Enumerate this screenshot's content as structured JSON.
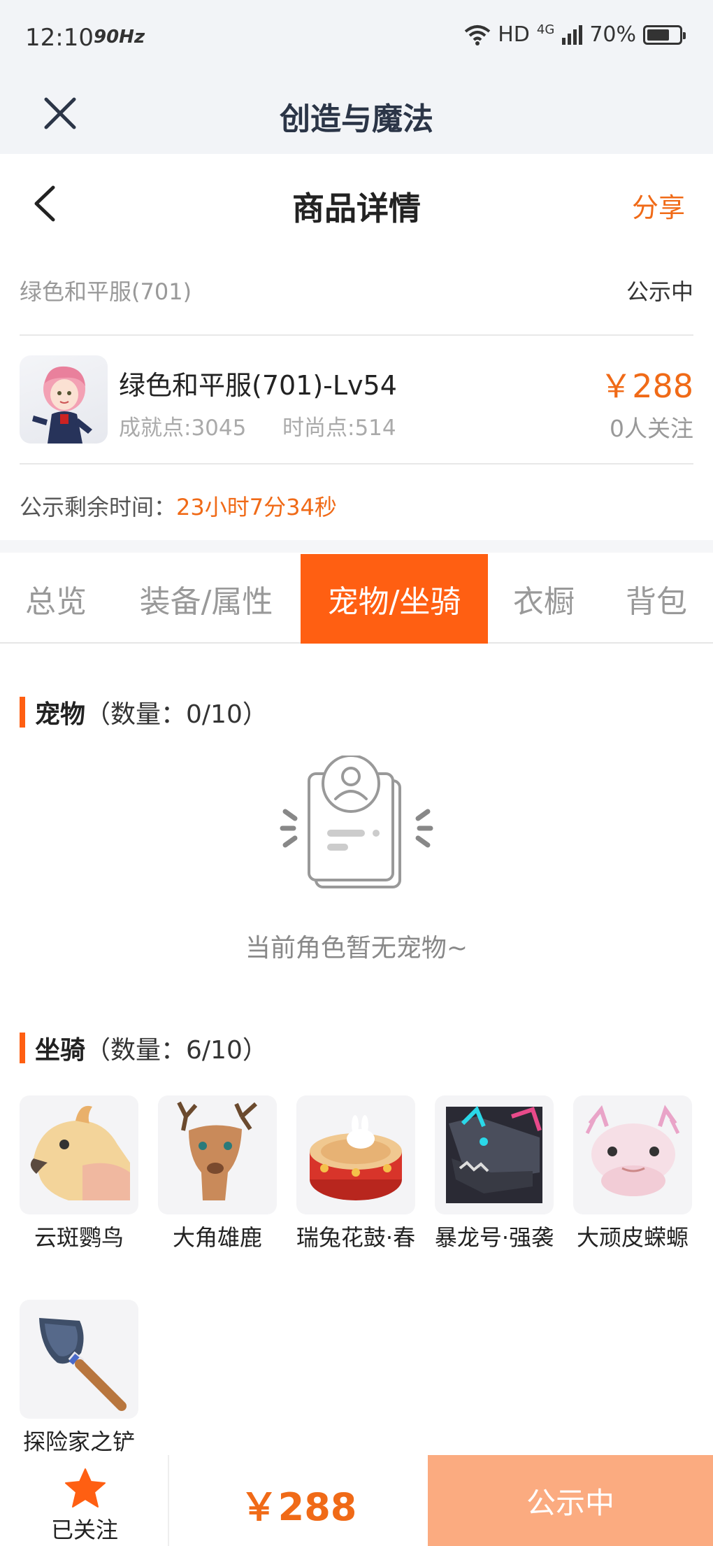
{
  "status_bar": {
    "time": "12:10",
    "refresh": "90Hz",
    "network": "HD",
    "signal": "4G",
    "battery": "70%",
    "battery_level": 0.7
  },
  "app": {
    "title": "创造与魔法",
    "close_icon": "close-icon"
  },
  "header": {
    "title": "商品详情",
    "share_label": "分享",
    "back_icon": "chevron-left-icon"
  },
  "listing": {
    "name": "绿色和平服(701)",
    "status": "公示中",
    "title": "绿色和平服(701)-Lv54",
    "achievement": "成就点:3045",
    "fashion": "时尚点:514",
    "price": "￥288",
    "followers": "0人关注",
    "timer_label": "公示剩余时间：",
    "timer_value": "23小时7分34秒"
  },
  "tabs": [
    {
      "label": "总览",
      "active": false
    },
    {
      "label": "装备/属性",
      "active": false
    },
    {
      "label": "宠物/坐骑",
      "active": true
    },
    {
      "label": "衣橱",
      "active": false
    },
    {
      "label": "背包",
      "active": false
    }
  ],
  "pets": {
    "title": "宠物",
    "count": "（数量：0/10）",
    "empty_text": "当前角色暂无宠物~"
  },
  "mounts": {
    "title": "坐骑",
    "count": "（数量：6/10）",
    "items": [
      {
        "name": "云斑鹦鸟"
      },
      {
        "name": "大角雄鹿"
      },
      {
        "name": "瑞兔花鼓·春"
      },
      {
        "name": "暴龙号·强袭"
      },
      {
        "name": "大顽皮蝾螈"
      },
      {
        "name": "探险家之铲"
      }
    ]
  },
  "bottom": {
    "fav_label": "已关注",
    "price": "￥288",
    "action_label": "公示中"
  },
  "colors": {
    "accent": "#ff5f12",
    "price": "#f06a17",
    "action_disabled": "#fbab80"
  }
}
